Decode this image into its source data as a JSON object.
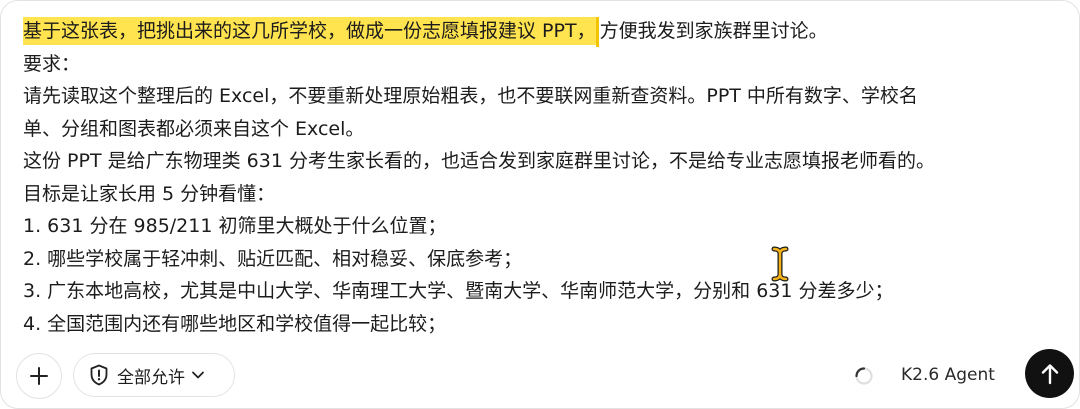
{
  "editor": {
    "line1_highlight_a": "基于这张表，",
    "line1_highlight_b": "把挑出来的这几所学校，做成一份志愿填报建议 PPT，",
    "line1_rest": "方便我发到家族群里讨论。",
    "line2": "要求：",
    "line3": "请先读取这个整理后的 Excel，不要重新处理原始粗表，也不要联网重新查资料。PPT 中所有数字、学校名",
    "line4": "单、分组和图表都必须来自这个 Excel。",
    "line5": "这份 PPT 是给广东物理类 631 分考生家长看的，也适合发到家庭群里讨论，不是给专业志愿填报老师看的。",
    "line6": "目标是让家长用 5 分钟看懂：",
    "line7": "1. 631 分在 985/211 初筛里大概处于什么位置；",
    "line8": "2. 哪些学校属于轻冲刺、贴近匹配、相对稳妥、保底参考；",
    "line9": "3. 广东本地高校，尤其是中山大学、华南理工大学、暨南大学、华南师范大学，分别和 631 分差多少；",
    "line10": "4. 全国范围内还有哪些地区和学校值得一起比较；"
  },
  "toolbar": {
    "add_icon": "plus-icon",
    "permission_icon": "shield-exclamation-icon",
    "permission_label": "全部允许",
    "permission_chevron": "chevron-down-icon",
    "status_icon": "loading-spinner-icon",
    "model_label": "K2.6 Agent",
    "send_icon": "arrow-up-icon"
  },
  "colors": {
    "highlight": "#ffe34f",
    "caret": "#f5c400",
    "send_button": "#111111",
    "text": "#1c1c1c"
  }
}
